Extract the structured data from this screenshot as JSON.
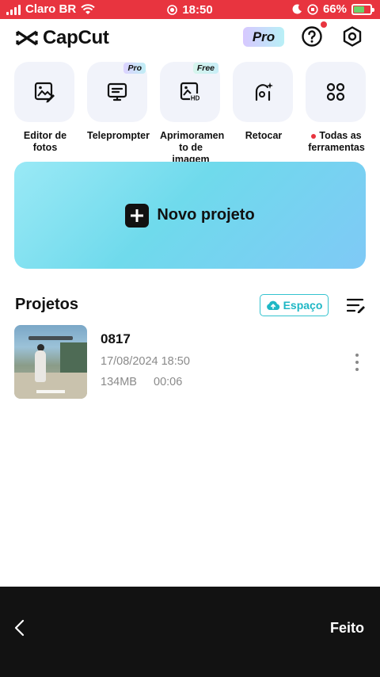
{
  "status_bar": {
    "carrier": "Claro BR",
    "time": "18:50",
    "battery": "66%",
    "battery_level": 0.66,
    "background_color": "#e8343f"
  },
  "header": {
    "app_name": "CapCut",
    "pro_label": "Pro",
    "help_icon": "help-circle-icon",
    "settings_icon": "settings-hexagon-icon",
    "notification_dot_color": "#e8343f"
  },
  "tools": [
    {
      "label": "Editor de fotos",
      "icon": "photo-edit-icon",
      "tag": ""
    },
    {
      "label": "Teleprompter",
      "icon": "teleprompter-icon",
      "tag": "Pro"
    },
    {
      "label": "Aprimoramen to de imagem",
      "icon": "image-hd-icon",
      "tag": "Free"
    },
    {
      "label": "Retocar",
      "icon": "retouch-face-icon",
      "tag": ""
    },
    {
      "label": "Todas as ferramentas",
      "icon": "grid-icon",
      "tag": ""
    }
  ],
  "new_project": {
    "label": "Novo projeto"
  },
  "projects": {
    "title": "Projetos",
    "space_button": "Espaço",
    "items": [
      {
        "name": "0817",
        "date": "17/08/2024 18:50",
        "size": "134MB",
        "duration": "00:06"
      }
    ]
  },
  "bottom_bar": {
    "done_label": "Feito"
  },
  "colors": {
    "accent": "#1fb7c5",
    "new_project_gradient_start": "#9ae9f6",
    "new_project_gradient_end": "#7fc9f6"
  }
}
